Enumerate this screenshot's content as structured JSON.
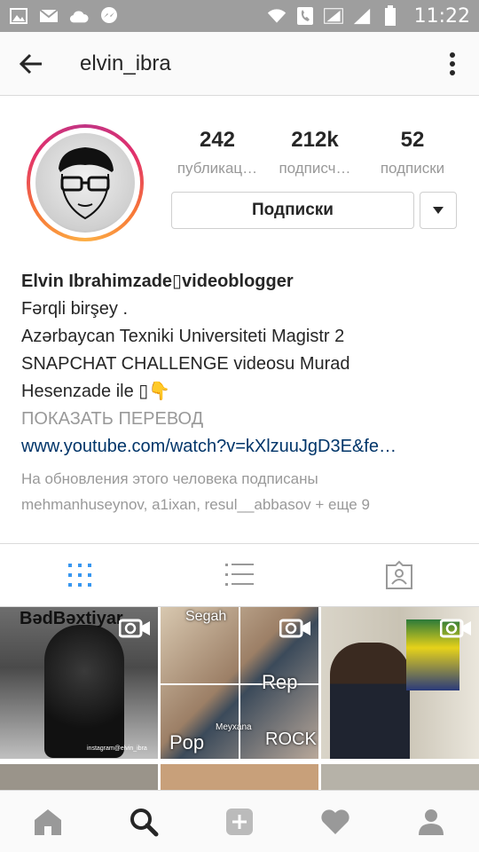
{
  "status_bar": {
    "time": "11:22",
    "left_icons": [
      "image-icon",
      "mail-icon",
      "cloud-icon",
      "messenger-icon"
    ],
    "right_icons": [
      "wifi-icon",
      "phone-icon",
      "signal-icon",
      "signal-icon",
      "battery-icon"
    ]
  },
  "header": {
    "username": "elvin_ibra"
  },
  "profile": {
    "stats": [
      {
        "value": "242",
        "label": "публикац…"
      },
      {
        "value": "212k",
        "label": "подписч…"
      },
      {
        "value": "52",
        "label": "подписки"
      }
    ],
    "follow_button_label": "Подписки"
  },
  "bio": {
    "name": "Elvin Ibrahimzade▯videoblogger",
    "lines": [
      "Fərqli birşey .",
      "Azərbaycan Texniki Universiteti Magistr 2",
      "SNAPCHAT CHALLENGE videosu Murad",
      "Hesenzade ile ▯👇"
    ],
    "translate_label": "ПОКАЗАТЬ ПЕРЕВОД",
    "link": "www.youtube.com/watch?v=kXlzuuJgD3E&fe…",
    "followed_by_line1": "На обновления этого человека подписаны",
    "followed_by_line2": "mehmanhuseynov, a1ixan, resul__abbasov + еще 9"
  },
  "grid": {
    "posts": [
      {
        "caption_top": "BədBəxtiyar",
        "caption_bottom": "instagram@elvin_ibra"
      },
      {
        "caption_top": "Segah",
        "labels": [
          "Rep",
          "Pop",
          "Meyxana",
          "ROCK"
        ]
      },
      {}
    ]
  },
  "colors": {
    "accent_blue": "#3897f0",
    "link_blue": "#003569",
    "muted": "#999999"
  }
}
